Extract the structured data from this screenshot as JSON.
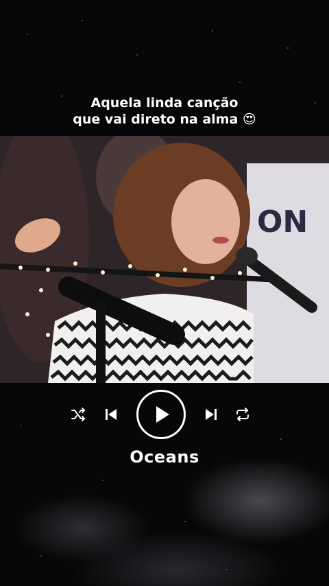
{
  "overlay": {
    "caption_line1": "Aquela linda canção",
    "caption_line2": "que vai direto na alma",
    "caption_emoji": "😍"
  },
  "player": {
    "track_title": "Oceans",
    "controls": [
      "shuffle-icon",
      "previous-icon",
      "play-icon",
      "next-icon",
      "repeat-icon"
    ]
  },
  "colors": {
    "background": "#060708",
    "controls": "#ffffff"
  }
}
